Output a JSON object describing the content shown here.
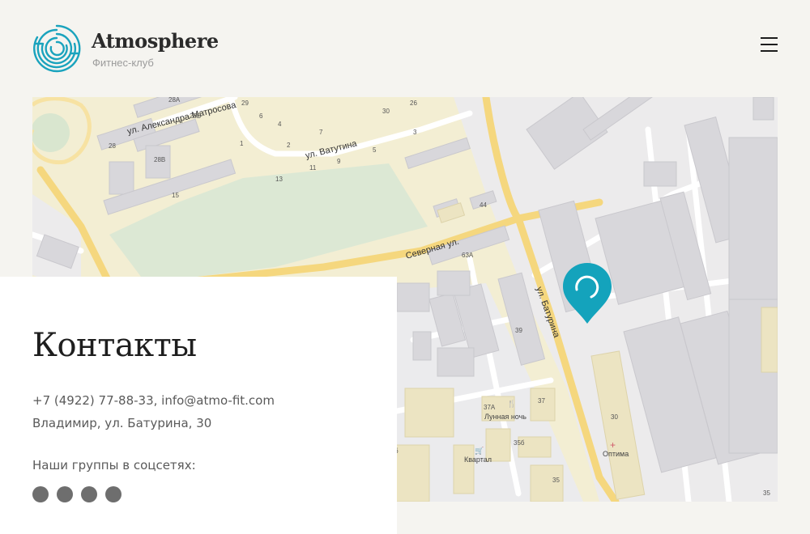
{
  "brand": {
    "name": "Atmosphere",
    "subtitle": "Фитнес-клуб",
    "accent_color": "#1aa3bd"
  },
  "header": {
    "menu_icon": "hamburger-menu-icon"
  },
  "map": {
    "marker_icon": "location-pin-icon",
    "marker_color": "#14a3bc",
    "street_labels": {
      "matrosova": "ул. Александра Матросова",
      "vatutina": "ул. Ватутина",
      "severnaya": "Северная ул.",
      "baturina": "ул. Батурина"
    },
    "house_numbers": {
      "h28a": "28А",
      "h28b": "28Б",
      "h28": "28",
      "h28v": "28В",
      "h15": "15",
      "h29": "29",
      "h6": "6",
      "h4": "4",
      "h7": "7",
      "h2": "2",
      "h1": "1",
      "h30a": "30",
      "h26": "26",
      "h3": "3",
      "h5": "5",
      "h11": "11",
      "h9": "9",
      "h13": "13",
      "h44": "44",
      "h63a": "63А",
      "h39": "39",
      "h37a": "37А",
      "h37": "37",
      "h35b": "35б",
      "h35": "35",
      "h30": "30",
      "h35r": "35",
      "h6l": "б"
    },
    "poi": {
      "lunnaya": "Лунная ночь",
      "kvartal": "Квартал",
      "optima": "Оптима"
    }
  },
  "contacts": {
    "title": "Контакты",
    "phone_email": "+7 (4922) 77-88-33, info@atmo-fit.com",
    "address": "Владимир, ул. Батурина, 30",
    "social_heading": "Наши группы в соцсетях:",
    "social_links": [
      "social-link-1",
      "social-link-2",
      "social-link-3",
      "social-link-4"
    ]
  }
}
